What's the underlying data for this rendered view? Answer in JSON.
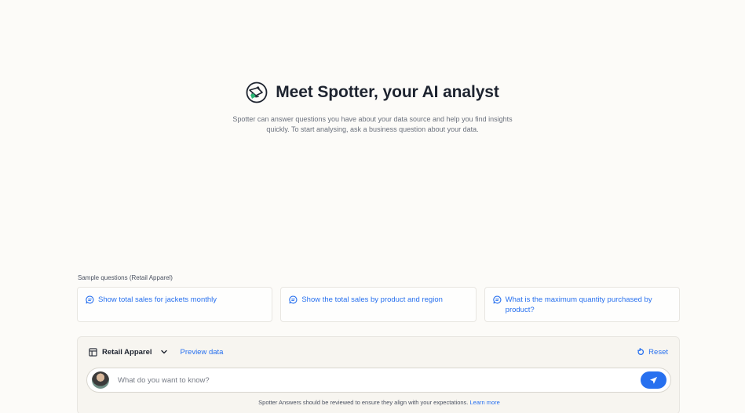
{
  "hero": {
    "title": "Meet Spotter, your AI analyst",
    "subtitle": "Spotter can answer questions you have about your data source and help you find insights quickly. To start analysing, ask a business question about your data.",
    "icon": "spotter-logo-icon"
  },
  "samples": {
    "label": "Sample questions (Retail Apparel)",
    "questions": [
      "Show total sales for jackets monthly",
      "Show the total sales by product and region",
      "What is the maximum quantity purchased by product?"
    ],
    "icon": "chat-bubble-icon"
  },
  "panel": {
    "data_source": "Retail Apparel",
    "preview_label": "Preview data",
    "reset_label": "Reset",
    "input_placeholder": "What do you want to know?",
    "input_value": "",
    "disclaimer": "Spotter Answers should be reviewed to ensure they align with your expectations.",
    "learn_more": "Learn more"
  },
  "colors": {
    "accent": "#2770ef",
    "background": "#fcfbf8",
    "panel": "#f7f5f0",
    "text": "#1d232f"
  }
}
